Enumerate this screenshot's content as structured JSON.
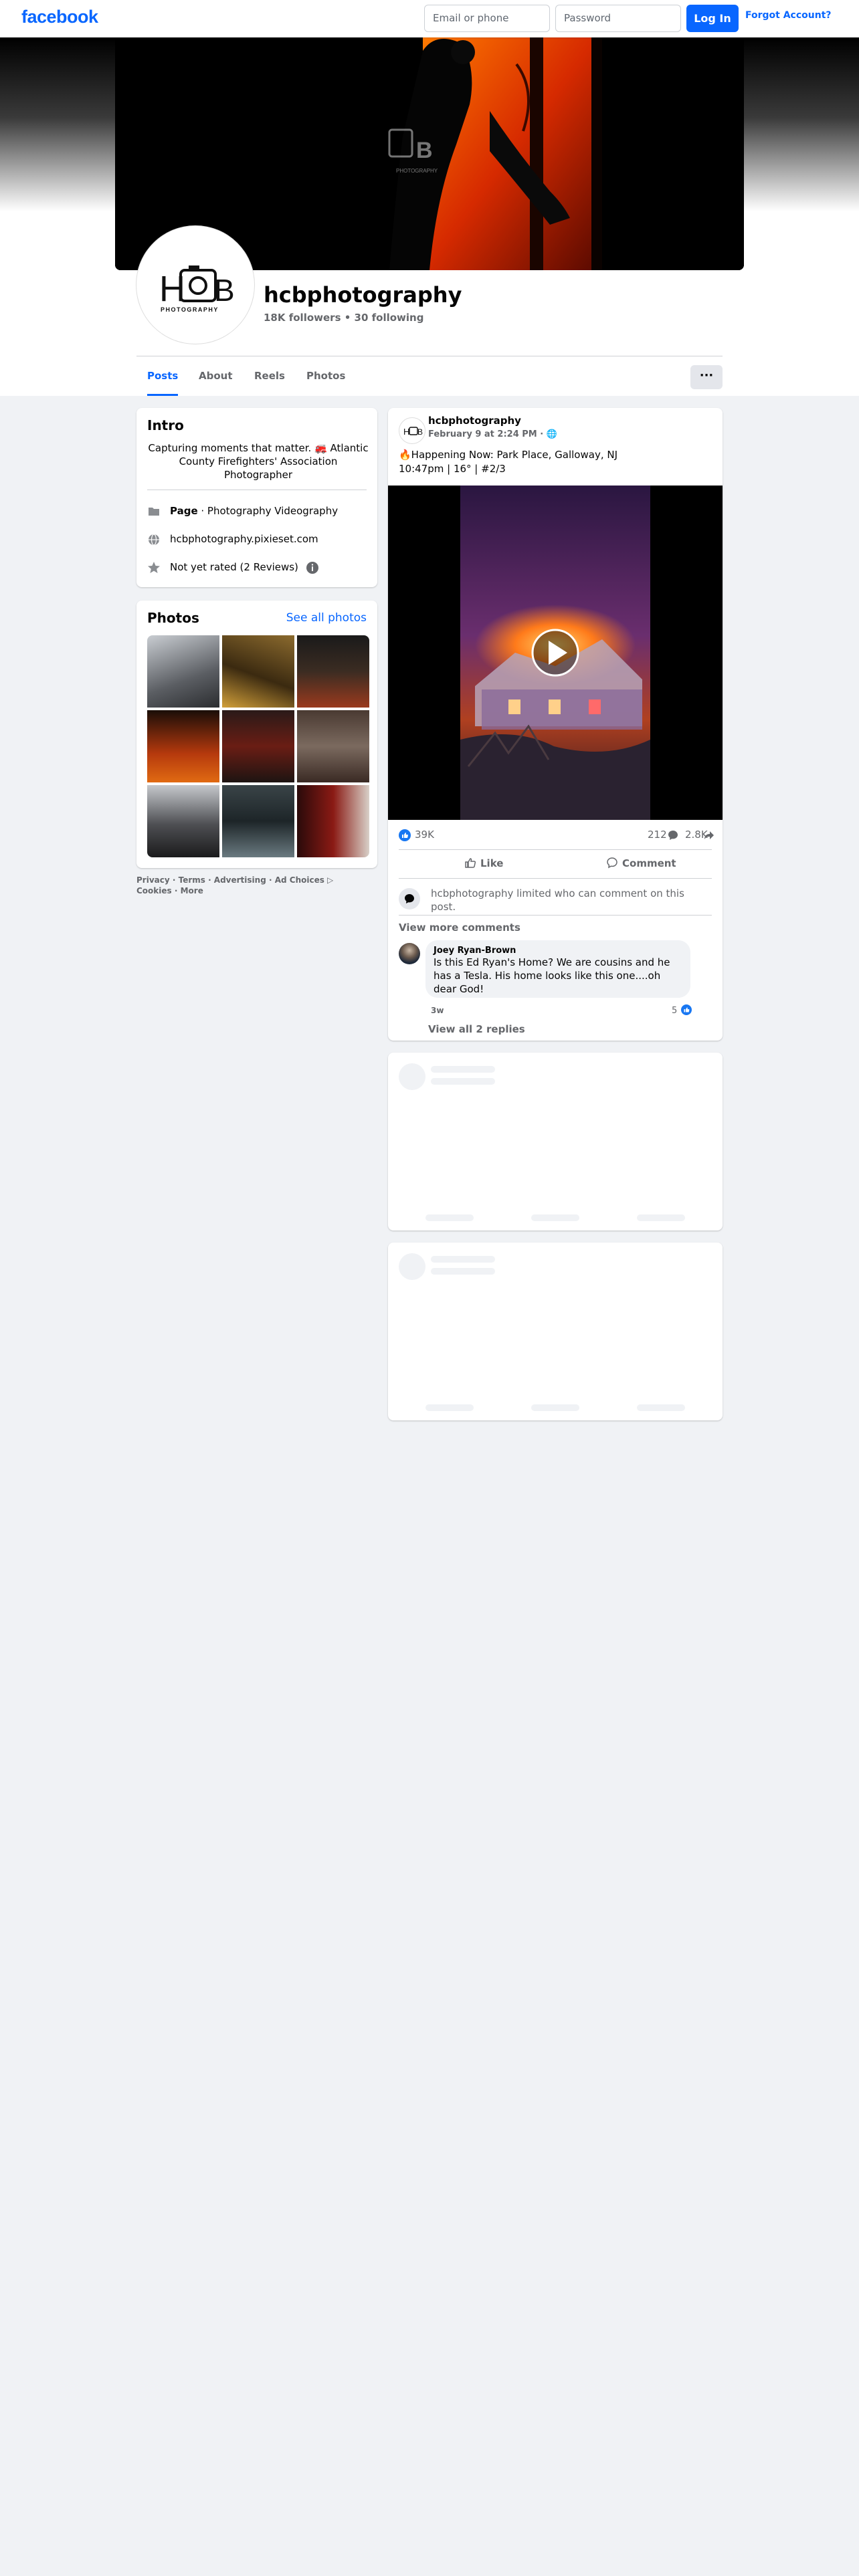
{
  "topbar": {
    "logo": "facebook",
    "email_placeholder": "Email or phone",
    "password_placeholder": "Password",
    "login_label": "Log In",
    "forgot_label": "Forgot Account?"
  },
  "profile": {
    "name": "hcbphotography",
    "stats": "18K followers • 30 following",
    "logo_text": "PHOTOGRAPHY"
  },
  "tabs": [
    {
      "label": "Posts",
      "active": true
    },
    {
      "label": "About"
    },
    {
      "label": "Reels"
    },
    {
      "label": "Photos"
    }
  ],
  "more_button": "···",
  "intro": {
    "title": "Intro",
    "bio": "Capturing moments that matter. 🚒 Atlantic County Firefighters' Association Photographer",
    "page_bold": "Page",
    "page_category": " · Photography Videography",
    "website": "hcbphotography.pixieset.com",
    "rating": "Not yet rated (2 Reviews)"
  },
  "photos": {
    "title": "Photos",
    "see_all": "See all photos"
  },
  "footer": {
    "line1": "Privacy · Terms · Advertising · Ad Choices ▷",
    "line2": "Cookies · More"
  },
  "post": {
    "author": "hcbphotography",
    "timestamp": "February 9 at 2:24 PM · 🌐",
    "line1": "🔥Happening Now: Park Place, Galloway, NJ",
    "line2": "10:47pm | 16° | #2/3",
    "reactions": "39K",
    "comments_count": "212",
    "shares_count": "2.8K",
    "like_label": "Like",
    "comment_label": "Comment",
    "limited_text": "hcbphotography limited who can comment on this post.",
    "view_more": "View more comments",
    "comment": {
      "name": "Joey Ryan-Brown",
      "text": "Is this Ed Ryan's Home? We are cousins and he has a Tesla. His home looks like this one....oh dear God!",
      "time": "3w",
      "likes": "5"
    },
    "view_replies": "View all 2 replies"
  },
  "colors": {
    "brand": "#0866ff",
    "background": "#f0f2f5",
    "secondary_text": "#65676b"
  }
}
